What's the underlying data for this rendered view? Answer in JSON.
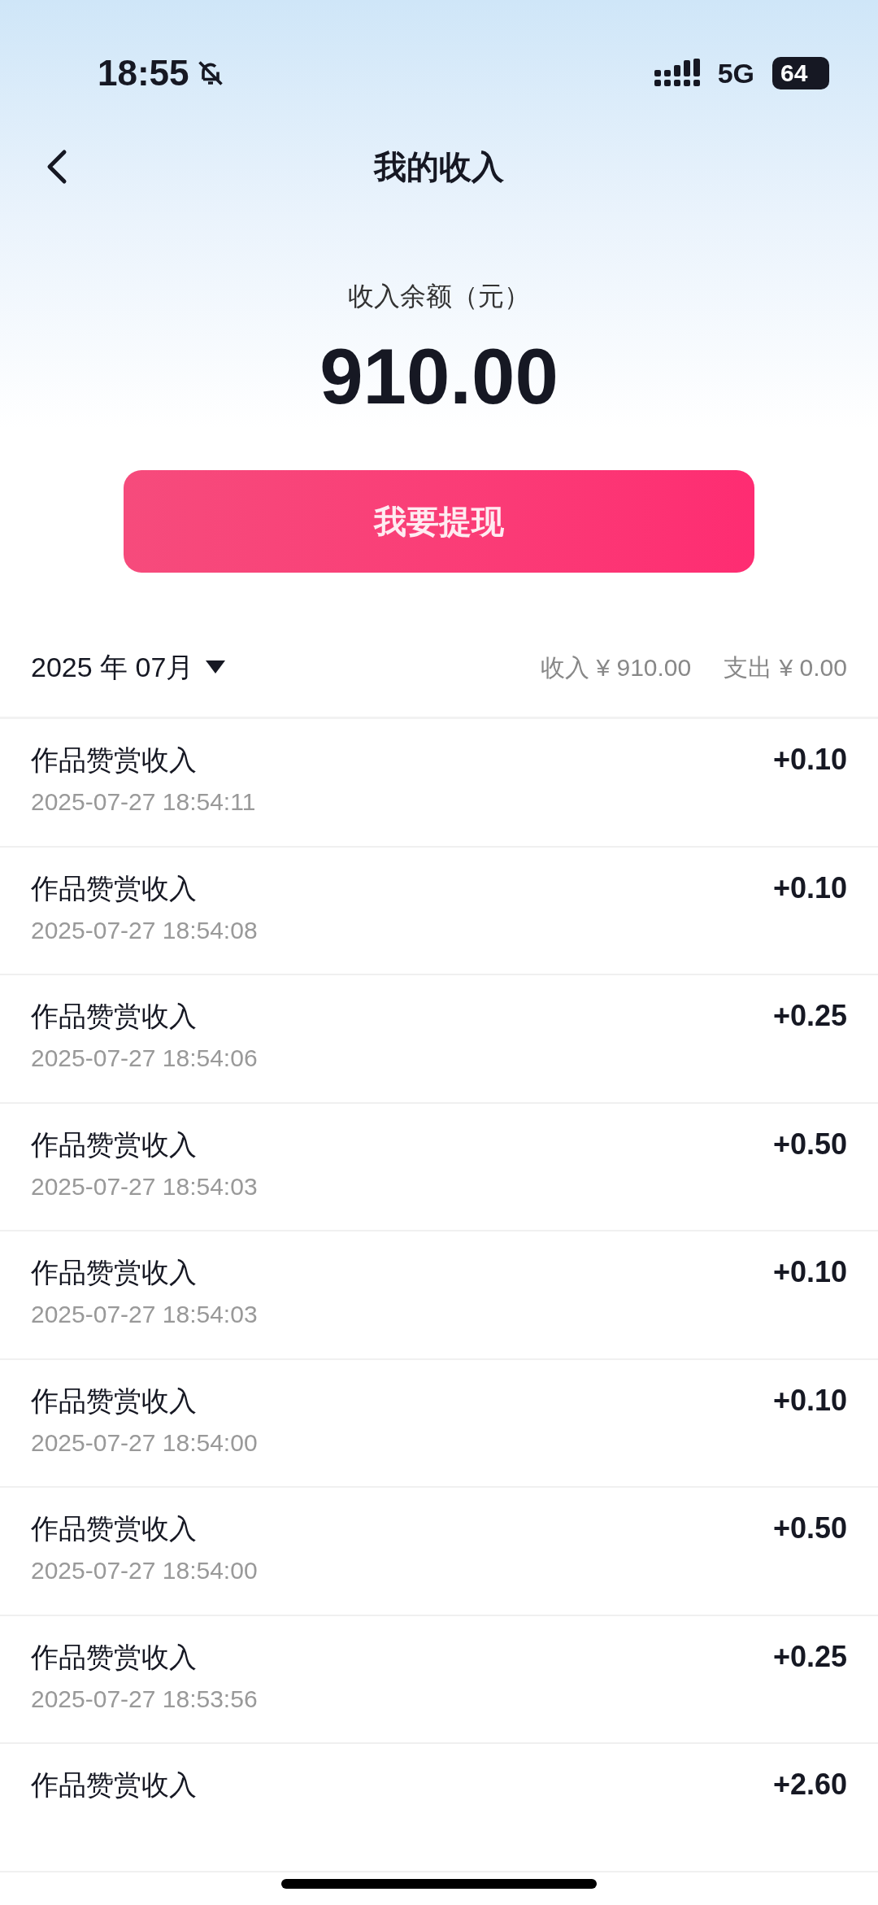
{
  "status_bar": {
    "time": "18:55",
    "network": "5G",
    "battery": "64"
  },
  "header": {
    "title": "我的收入"
  },
  "balance": {
    "label": "收入余额（元）",
    "amount": "910.00"
  },
  "withdraw_button": "我要提现",
  "filter": {
    "month": "2025 年 07月",
    "income": "收入 ¥ 910.00",
    "expense": "支出 ¥ 0.00"
  },
  "records": [
    {
      "title": "作品赞赏收入",
      "time": "2025-07-27 18:54:11",
      "amount": "+0.10"
    },
    {
      "title": "作品赞赏收入",
      "time": "2025-07-27 18:54:08",
      "amount": "+0.10"
    },
    {
      "title": "作品赞赏收入",
      "time": "2025-07-27 18:54:06",
      "amount": "+0.25"
    },
    {
      "title": "作品赞赏收入",
      "time": "2025-07-27 18:54:03",
      "amount": "+0.50"
    },
    {
      "title": "作品赞赏收入",
      "time": "2025-07-27 18:54:03",
      "amount": "+0.10"
    },
    {
      "title": "作品赞赏收入",
      "time": "2025-07-27 18:54:00",
      "amount": "+0.10"
    },
    {
      "title": "作品赞赏收入",
      "time": "2025-07-27 18:54:00",
      "amount": "+0.50"
    },
    {
      "title": "作品赞赏收入",
      "time": "2025-07-27 18:53:56",
      "amount": "+0.25"
    },
    {
      "title": "作品赞赏收入",
      "amount": "+2.60"
    }
  ]
}
